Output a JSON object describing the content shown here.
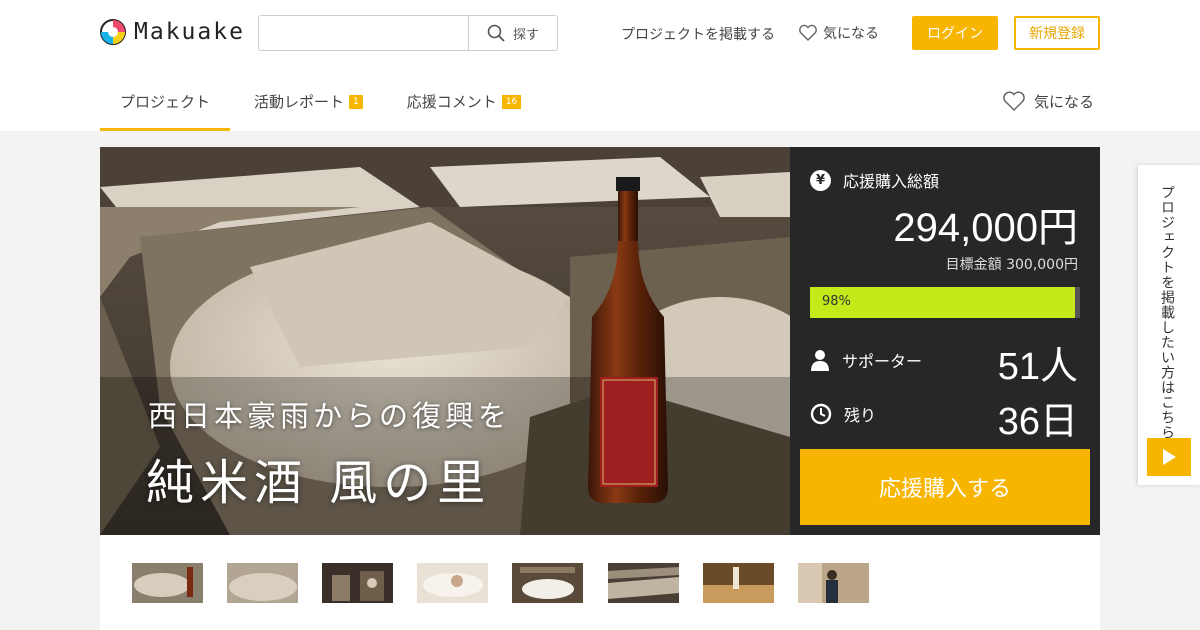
{
  "header": {
    "logo_text": "Makuake",
    "search": {
      "placeholder": "",
      "button_label": "探す"
    },
    "post_project_label": "プロジェクトを掲載する",
    "favorite_label": "気になる",
    "login_label": "ログイン",
    "signup_label": "新規登録"
  },
  "tabs": [
    {
      "label": "プロジェクト",
      "badge": "",
      "active": true
    },
    {
      "label": "活動レポート",
      "badge": "1",
      "active": false
    },
    {
      "label": "応援コメント",
      "badge": "16",
      "active": false
    }
  ],
  "tab_favorite_label": "気になる",
  "hero": {
    "subtitle": "西日本豪雨からの復興を",
    "title": "純米酒 風の里"
  },
  "panel": {
    "total_label": "応援購入総額",
    "total_amount": "294,000円",
    "goal_text": "目標金額 300,000円",
    "progress_percent": 98,
    "progress_label": "98%",
    "supporters_label": "サポーター",
    "supporters_value": "51人",
    "remaining_label": "残り",
    "remaining_value": "36日",
    "buy_button_label": "応援購入する",
    "currency_icon": "¥"
  },
  "floating": {
    "text": "プロジェクトを掲載したい方はこちら"
  },
  "colors": {
    "accent": "#f7b500",
    "panel_bg": "#272727",
    "progress": "#c4ea1a"
  },
  "thumbnails": [
    {
      "name": "thumbnail-1"
    },
    {
      "name": "thumbnail-2"
    },
    {
      "name": "thumbnail-3"
    },
    {
      "name": "thumbnail-4"
    },
    {
      "name": "thumbnail-5"
    },
    {
      "name": "thumbnail-6"
    },
    {
      "name": "thumbnail-7"
    },
    {
      "name": "thumbnail-8"
    }
  ]
}
